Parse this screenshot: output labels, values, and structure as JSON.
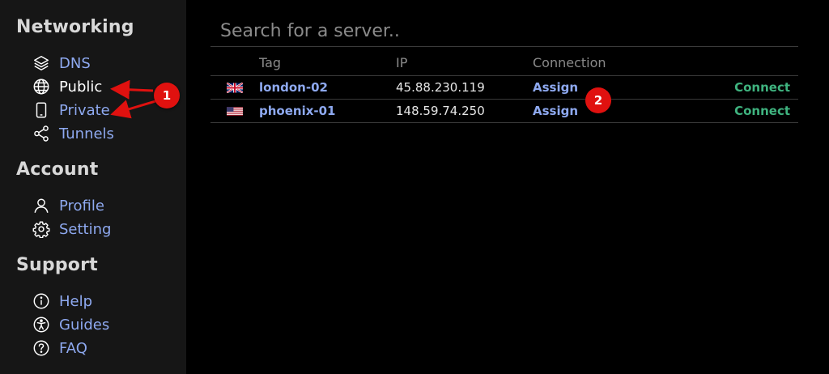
{
  "sidebar": {
    "sections": [
      {
        "title": "Networking",
        "items": [
          {
            "label": "DNS",
            "icon": "layers-icon"
          },
          {
            "label": "Public",
            "icon": "globe-icon"
          },
          {
            "label": "Private",
            "icon": "mobile-icon"
          },
          {
            "label": "Tunnels",
            "icon": "share-icon"
          }
        ]
      },
      {
        "title": "Account",
        "items": [
          {
            "label": "Profile",
            "icon": "user-icon"
          },
          {
            "label": "Setting",
            "icon": "gear-icon"
          }
        ]
      },
      {
        "title": "Support",
        "items": [
          {
            "label": "Help",
            "icon": "info-icon"
          },
          {
            "label": "Guides",
            "icon": "accessibility-icon"
          },
          {
            "label": "FAQ",
            "icon": "question-icon"
          }
        ]
      }
    ]
  },
  "search": {
    "placeholder": "Search for a server.."
  },
  "table": {
    "headers": [
      "Tag",
      "IP",
      "Connection"
    ],
    "rows": [
      {
        "flag": "uk-flag-icon",
        "tag": "london-02",
        "ip": "45.88.230.119",
        "assign": "Assign",
        "connect": "Connect"
      },
      {
        "flag": "us-flag-icon",
        "tag": "phoenix-01",
        "ip": "148.59.74.250",
        "assign": "Assign",
        "connect": "Connect"
      }
    ]
  },
  "annotations": {
    "marker1": "1",
    "marker2": "2"
  },
  "colors": {
    "link": "#8ea9f0",
    "connect": "#3fb37f",
    "marker": "#e0110f"
  }
}
